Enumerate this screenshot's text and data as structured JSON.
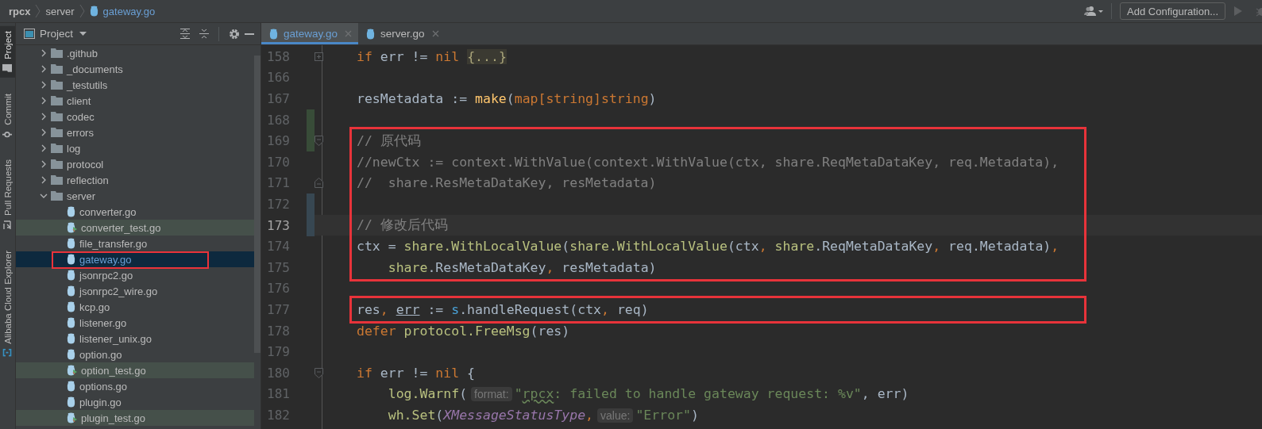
{
  "breadcrumb": [
    {
      "text": "rpcx",
      "kind": "project"
    },
    {
      "text": "server",
      "kind": "folder"
    },
    {
      "text": "gateway.go",
      "kind": "file"
    }
  ],
  "toolbar": {
    "run_configuration": "Add Configuration..."
  },
  "tool_window_tabs": [
    {
      "label": "Project",
      "selected": true
    },
    {
      "label": "Commit",
      "selected": false
    },
    {
      "label": "Pull Requests",
      "selected": false
    },
    {
      "label": "Alibaba Cloud Explorer",
      "selected": false
    }
  ],
  "project_panel": {
    "title": "Project",
    "tree": [
      {
        "name": ".github",
        "kind": "folder",
        "expanded": false,
        "selected": false,
        "boxed": false
      },
      {
        "name": "_documents",
        "kind": "folder",
        "expanded": false,
        "selected": false,
        "boxed": false
      },
      {
        "name": "_testutils",
        "kind": "folder",
        "expanded": false,
        "selected": false,
        "boxed": false
      },
      {
        "name": "client",
        "kind": "folder",
        "expanded": false,
        "selected": false,
        "boxed": false
      },
      {
        "name": "codec",
        "kind": "folder",
        "expanded": false,
        "selected": false,
        "boxed": false
      },
      {
        "name": "errors",
        "kind": "folder",
        "expanded": false,
        "selected": false,
        "boxed": false
      },
      {
        "name": "log",
        "kind": "folder",
        "expanded": false,
        "selected": false,
        "boxed": false
      },
      {
        "name": "protocol",
        "kind": "folder",
        "expanded": false,
        "selected": false,
        "boxed": false
      },
      {
        "name": "reflection",
        "kind": "folder",
        "expanded": false,
        "selected": false,
        "boxed": false
      },
      {
        "name": "server",
        "kind": "folder",
        "expanded": true,
        "selected": false,
        "boxed": false,
        "children": [
          {
            "name": "converter.go",
            "kind": "file",
            "selected": false,
            "boxed": false
          },
          {
            "name": "converter_test.go",
            "kind": "test",
            "selected": false,
            "boxed": false
          },
          {
            "name": "file_transfer.go",
            "kind": "file",
            "selected": false,
            "boxed": false
          },
          {
            "name": "gateway.go",
            "kind": "file",
            "selected": true,
            "boxed": true
          },
          {
            "name": "jsonrpc2.go",
            "kind": "file",
            "selected": false,
            "boxed": false
          },
          {
            "name": "jsonrpc2_wire.go",
            "kind": "file",
            "selected": false,
            "boxed": false
          },
          {
            "name": "kcp.go",
            "kind": "file",
            "selected": false,
            "boxed": false
          },
          {
            "name": "listener.go",
            "kind": "file",
            "selected": false,
            "boxed": false
          },
          {
            "name": "listener_unix.go",
            "kind": "file",
            "selected": false,
            "boxed": false
          },
          {
            "name": "option.go",
            "kind": "file",
            "selected": false,
            "boxed": false
          },
          {
            "name": "option_test.go",
            "kind": "test",
            "selected": false,
            "boxed": false
          },
          {
            "name": "options.go",
            "kind": "file",
            "selected": false,
            "boxed": false
          },
          {
            "name": "plugin.go",
            "kind": "file",
            "selected": false,
            "boxed": false
          },
          {
            "name": "plugin_test.go",
            "kind": "test",
            "selected": false,
            "boxed": false
          }
        ]
      }
    ]
  },
  "editor_tabs": [
    {
      "label": "gateway.go",
      "selected": true,
      "modified": true
    },
    {
      "label": "server.go",
      "selected": false,
      "modified": false
    }
  ],
  "code_lines": [
    {
      "number": "158",
      "fold": {
        "kind": "collapsed"
      },
      "current": false,
      "boxed": false,
      "tokens": [
        {
          "text": "if",
          "kind": "keyword"
        },
        {
          "text": " err != ",
          "kind": "plain"
        },
        {
          "text": "nil",
          "kind": "keyword"
        },
        {
          "text": "{...}",
          "kind": "folded"
        }
      ]
    },
    {
      "number": "166",
      "current": false,
      "boxed": false
    },
    {
      "number": "167",
      "current": false,
      "boxed": false,
      "tokens": [
        {
          "text": "resMetadata := ",
          "kind": "plain"
        },
        {
          "text": "make",
          "kind": "function"
        },
        {
          "text": "(",
          "kind": "plain"
        },
        {
          "text": "map[string]string",
          "kind": "keyword"
        },
        {
          "text": ")",
          "kind": "plain"
        }
      ]
    },
    {
      "number": "168",
      "change": {
        "kind": "added"
      },
      "current": false,
      "boxed": false
    },
    {
      "number": "169",
      "fold": {
        "kind": "start"
      },
      "change": {
        "kind": "added"
      },
      "current": false,
      "boxed": true,
      "tokens": [
        {
          "text": "// 原代码",
          "kind": "comment"
        }
      ]
    },
    {
      "number": "170",
      "current": false,
      "boxed": true,
      "tokens": [
        {
          "text": "//newCtx := context.WithValue(context.WithValue(ctx, share.ReqMetaDataKey, req.Metadata),",
          "kind": "comment"
        }
      ]
    },
    {
      "number": "171",
      "fold": {
        "kind": "end"
      },
      "current": false,
      "boxed": true,
      "tokens": [
        {
          "text": "//  share.ResMetaDataKey, resMetadata)",
          "kind": "comment"
        }
      ]
    },
    {
      "number": "172",
      "change": {
        "kind": "modified"
      },
      "current": false,
      "boxed": true
    },
    {
      "number": "173",
      "change": {
        "kind": "modified"
      },
      "current": true,
      "boxed": true,
      "tokens": [
        {
          "text": "// 修改后代码",
          "kind": "comment"
        }
      ]
    },
    {
      "number": "174",
      "current": false,
      "boxed": true,
      "tokens": [
        {
          "text": "ctx = ",
          "kind": "plain"
        },
        {
          "text": "share.WithLocalValue",
          "kind": "package"
        },
        {
          "text": "(",
          "kind": "plain"
        },
        {
          "text": "share.WithLocalValue",
          "kind": "package"
        },
        {
          "text": "(ctx",
          "kind": "plain"
        },
        {
          "text": ", ",
          "kind": "punct"
        },
        {
          "text": "share",
          "kind": "package"
        },
        {
          "text": ".ReqMetaDataKey",
          "kind": "plain"
        },
        {
          "text": ", ",
          "kind": "punct"
        },
        {
          "text": "req.Metadata)",
          "kind": "plain"
        },
        {
          "text": ",",
          "kind": "punct"
        }
      ]
    },
    {
      "number": "175",
      "current": false,
      "boxed": true,
      "tokens": [
        {
          "text": "    share",
          "kind": "package"
        },
        {
          "text": ".ResMetaDataKey",
          "kind": "plain"
        },
        {
          "text": ", ",
          "kind": "punct"
        },
        {
          "text": "resMetadata)",
          "kind": "plain"
        }
      ]
    },
    {
      "number": "176",
      "current": false,
      "boxed": false
    },
    {
      "number": "177",
      "current": false,
      "boxed": true,
      "tokens": [
        {
          "text": "res",
          "kind": "plain"
        },
        {
          "text": ", ",
          "kind": "punct"
        },
        {
          "text": "err",
          "kind": "underlined"
        },
        {
          "text": " := ",
          "kind": "plain"
        },
        {
          "text": "s",
          "kind": "receiver"
        },
        {
          "text": ".handleRequest(ctx",
          "kind": "plain"
        },
        {
          "text": ", ",
          "kind": "punct"
        },
        {
          "text": "req)",
          "kind": "plain"
        }
      ]
    },
    {
      "number": "178",
      "current": false,
      "boxed": false,
      "tokens": [
        {
          "text": "defer",
          "kind": "keyword"
        },
        {
          "text": " protocol.FreeMsg",
          "kind": "package"
        },
        {
          "text": "(res)",
          "kind": "plain"
        }
      ]
    },
    {
      "number": "179",
      "current": false,
      "boxed": false
    },
    {
      "number": "180",
      "fold": {
        "kind": "start"
      },
      "current": false,
      "boxed": false,
      "tokens": [
        {
          "text": "if",
          "kind": "keyword"
        },
        {
          "text": " err != ",
          "kind": "plain"
        },
        {
          "text": "nil",
          "kind": "keyword"
        },
        {
          "text": " {",
          "kind": "plain"
        }
      ]
    },
    {
      "number": "181",
      "current": false,
      "boxed": false,
      "tokens": [
        {
          "text": "    log.Warnf",
          "kind": "package"
        },
        {
          "text": "(",
          "kind": "plain"
        },
        {
          "text": "format:",
          "kind": "hint"
        },
        {
          "text": "\"",
          "kind": "string"
        },
        {
          "text": "rpcx",
          "kind": "typo"
        },
        {
          "text": ": failed to handle gateway request: %v\"",
          "kind": "string"
        },
        {
          "text": ", err)",
          "kind": "plain"
        }
      ]
    },
    {
      "number": "182",
      "current": false,
      "boxed": false,
      "tokens": [
        {
          "text": "    wh.Set",
          "kind": "package"
        },
        {
          "text": "(",
          "kind": "plain"
        },
        {
          "text": "XMessageStatusType",
          "kind": "constant"
        },
        {
          "text": ",",
          "kind": "punct"
        },
        {
          "text": "value:",
          "kind": "hint"
        },
        {
          "text": "\"Error\"",
          "kind": "string"
        },
        {
          "text": ")",
          "kind": "plain"
        }
      ]
    }
  ]
}
